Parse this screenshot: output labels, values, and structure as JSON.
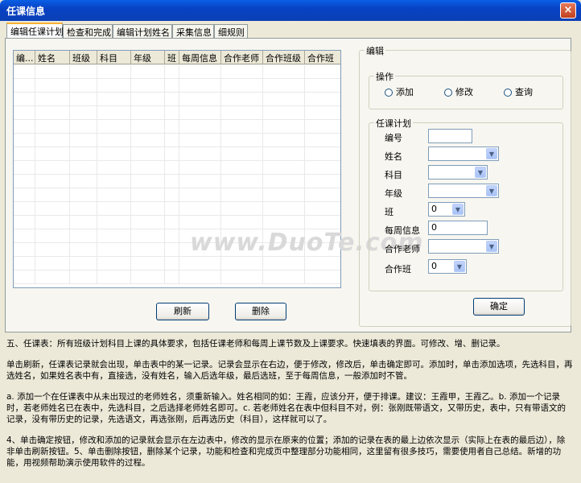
{
  "window": {
    "title": "任课信息",
    "close_glyph": "×"
  },
  "tabs": [
    "编辑任课计划",
    "检查和完成",
    "编辑计划姓名",
    "采集信息",
    "细规则"
  ],
  "grid": {
    "columns": [
      "编...",
      "姓名",
      "班级",
      "科目",
      "年级",
      "班",
      "每周信息",
      "合作老师",
      "合作班级",
      "合作班"
    ]
  },
  "buttons": {
    "refresh": "刷新",
    "delete": "删除",
    "confirm": "确定"
  },
  "edit_panel": {
    "title": "编辑",
    "operation": {
      "title": "操作",
      "options": [
        "添加",
        "修改",
        "查询"
      ]
    },
    "plan": {
      "title": "任课计划",
      "fields": {
        "id": {
          "label": "编号",
          "value": ""
        },
        "name": {
          "label": "姓名",
          "value": ""
        },
        "subject": {
          "label": "科目",
          "value": ""
        },
        "grade": {
          "label": "年级",
          "value": ""
        },
        "class": {
          "label": "班",
          "value": "0"
        },
        "weekly": {
          "label": "每周信息",
          "value": "0"
        },
        "coteacher": {
          "label": "合作老师",
          "value": ""
        },
        "coclass": {
          "label": "合作班",
          "value": "0"
        }
      }
    }
  },
  "help": [
    "五、任课表：所有班级计划科目上课的具体要求，包括任课老师和每周上课节数及上课要求。快速填表的界面。可修改、增、删记录。",
    "单击刷新，任课表记录就会出现，单击表中的某一记录。记录会显示在右边，便于修改，修改后，单击确定即可。添加时，单击添加选项，先选科目，再选姓名，如果姓名表中有，直接选，没有姓名，输入后选年级，最后选班，至于每周信息，一般添加时不管。",
    "a. 添加一个在任课表中从未出现过的老师姓名，须重新输入。姓名相同的如：王霞，应该分开，便于排课。建议：王霞甲，王霞乙。b. 添加一个记录时，若老师姓名已在表中，先选科目，之后选择老师姓名即可。c. 若老师姓名在表中但科目不对，例：张刚既带语文，又带历史，表中，只有带语文的记录，没有带历史的记录，先选语文，再选张刚，后再选历史（科目），这样就可以了。",
    "4、单击确定按钮，修改和添加的记录就会显示在左边表中，修改的显示在原来的位置；添加的记录在表的最上边依次显示（实际上在表的最后边），除非单击刷新按钮。5、单击删除按钮，删除某个记录，功能和检查和完成页中整理部分功能相同，这里留有很多技巧，需要使用者自己总结。新增的功能，用视频帮助演示使用软件的过程。"
  ],
  "watermark": "www.DuoTe.com"
}
